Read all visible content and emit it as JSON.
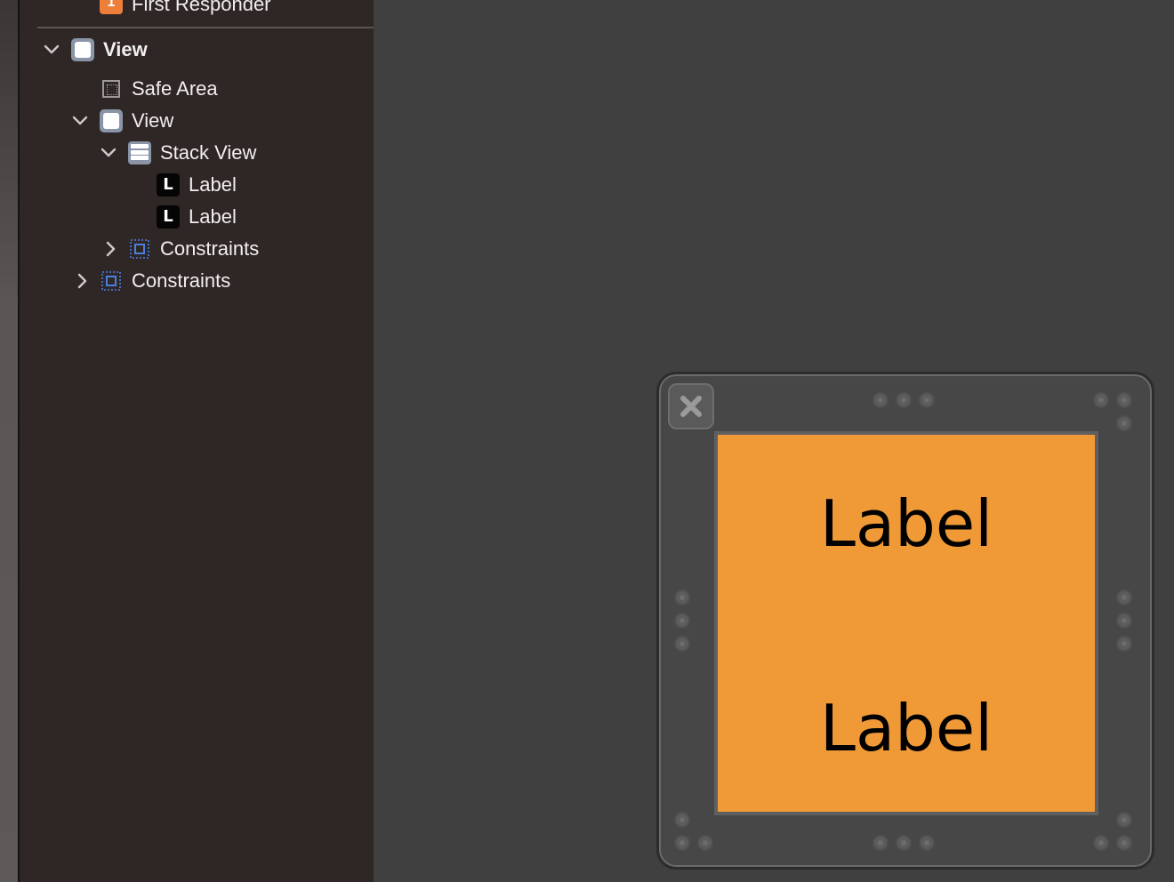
{
  "outline": {
    "first_responder": "First Responder",
    "first_responder_icon_letter": "1",
    "view_root": "View",
    "safe_area": "Safe Area",
    "view_child": "View",
    "stack_view": "Stack View",
    "label_1": "Label",
    "label_2": "Label",
    "constraints_inner": "Constraints",
    "constraints_outer": "Constraints",
    "label_icon_letter": "L"
  },
  "canvas": {
    "label_top": "Label",
    "label_bottom": "Label",
    "view_background": "#f09937"
  },
  "colors": {
    "outline_bg": "#2f2726",
    "canvas_bg": "#404040",
    "constraint_icon": "#4a7fe0",
    "responder_icon": "#ee7f3a"
  }
}
